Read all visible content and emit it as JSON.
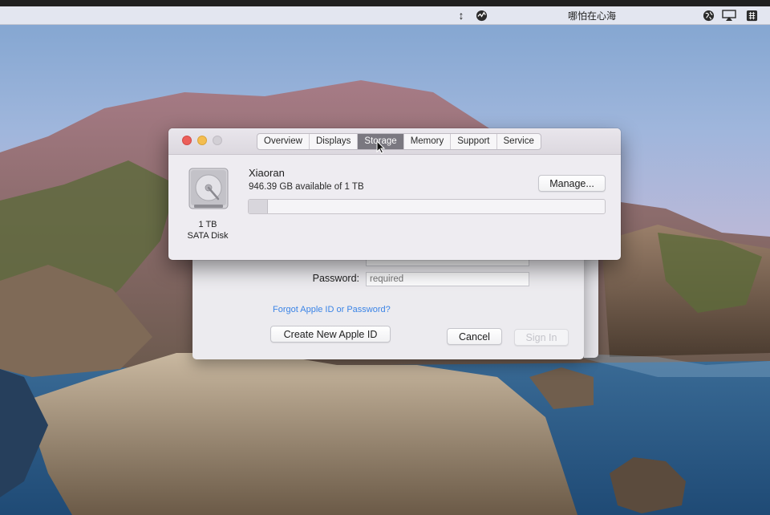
{
  "menubar": {
    "user_name": "哪怕在心海",
    "icons": [
      "arrows-updown-icon",
      "activity-monitor-icon",
      "globe-icon",
      "airplay-icon",
      "input-grid-icon"
    ]
  },
  "about_window": {
    "tabs": [
      {
        "label": "Overview",
        "active": false
      },
      {
        "label": "Displays",
        "active": false
      },
      {
        "label": "Storage",
        "active": true
      },
      {
        "label": "Memory",
        "active": false
      },
      {
        "label": "Support",
        "active": false
      },
      {
        "label": "Service",
        "active": false
      }
    ],
    "disk": {
      "size_label": "1 TB",
      "type_label": "SATA Disk"
    },
    "volume": {
      "name": "Xiaoran",
      "available_text": "946.39 GB available of 1 TB",
      "used_fraction": 0.054
    },
    "manage_label": "Manage..."
  },
  "signin_window": {
    "apple_id_value": "",
    "password_label": "Password:",
    "password_placeholder": "required",
    "forgot_link": "Forgot Apple ID or Password?",
    "create_button": "Create New Apple ID",
    "cancel_button": "Cancel",
    "signin_button": "Sign In"
  },
  "colors": {
    "accent_link": "#3b84e6",
    "close": "#ec5f5a",
    "minimize": "#f4bd4f",
    "active_tab": "#7a7880"
  }
}
